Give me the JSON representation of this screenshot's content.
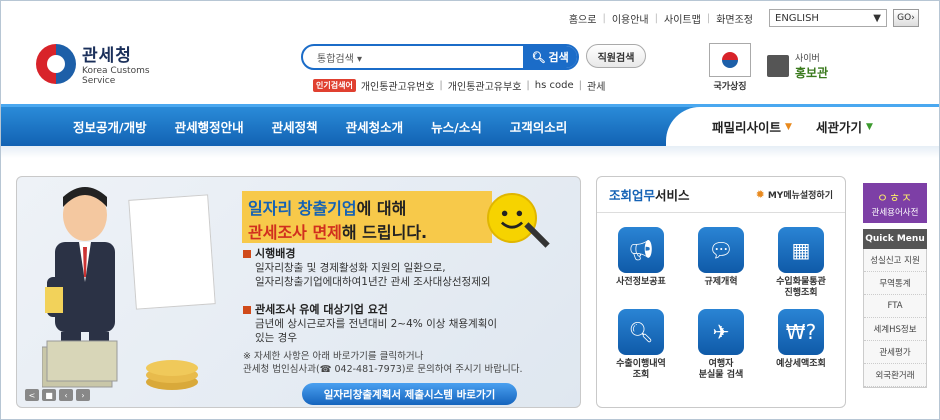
{
  "utility": {
    "home": "홈으로",
    "guide": "이용안내",
    "sitemap": "사이트맵",
    "zoom": "화면조정",
    "language": "ENGLISH",
    "go": "GO"
  },
  "logo": {
    "korean": "관세청",
    "english_line1": "Korea Customs",
    "english_line2": "Service"
  },
  "search": {
    "scope": "통합검색",
    "button": "검색",
    "staff_search": "직원검색"
  },
  "popular": {
    "tag": "인기검색어",
    "terms": [
      "개인통관고유번호",
      "개인통관고유부호",
      "hs code",
      "관세"
    ]
  },
  "flag": {
    "label": "국가상징"
  },
  "cyber": {
    "line1": "사이버",
    "line2": "홍보관"
  },
  "nav": {
    "items": [
      "정보공개/개방",
      "관세행정안내",
      "관세정책",
      "관세청소개",
      "뉴스/소식",
      "고객의소리"
    ],
    "family": "패밀리사이트",
    "tariff": "세관가기"
  },
  "banner": {
    "h1_a": "일자리 창출기업",
    "h1_b": "에 대해",
    "h2_a": "관세조사 면제",
    "h2_b": "해 드립니다.",
    "s1_title": "시행배경",
    "s1_text1": "일자리창출 및 경제활성화 지원의 일환으로,",
    "s1_text2": "일자리창출기업에대하여1년간 관세 조사대상선정제외",
    "s2_title": "관세조사 유예 대상기업 요건",
    "s2_text1": "금년에 상시근로자를 전년대비 2~4% 이상 채용계획이",
    "s2_text2": "있는 경우",
    "note1": "※ 자세한 사항은  아래 바로가기를  클릭하거나",
    "note2": "관세청 법인심사과(☎ 042-481-7973)로 문의하여 주시기 바랍니다.",
    "cta": "일자리창출계획서 제출시스템 바로가기",
    "controls": [
      "<",
      "■",
      "‹",
      "›"
    ]
  },
  "services": {
    "title_a": "조회업무",
    "title_b": "서비스",
    "my_menu": "MY메뉴설정하기",
    "items": [
      {
        "label1": "사전정보공표",
        "label2": "",
        "icon": "megaphone-icon"
      },
      {
        "label1": "규제개혁",
        "label2": "",
        "icon": "speech-bubble-icon"
      },
      {
        "label1": "수입화물통관",
        "label2": "진행조회",
        "icon": "boxes-search-icon"
      },
      {
        "label1": "수출이행내역",
        "label2": "조회",
        "icon": "magnifier-icon"
      },
      {
        "label1": "여행자",
        "label2": "분실물 검색",
        "icon": "airplane-luggage-icon"
      },
      {
        "label1": "예상세액조회",
        "label2": "",
        "icon": "won-question-icon"
      }
    ]
  },
  "quick": {
    "dict_symbol": "ㅇㅎㅈ",
    "dict_label": "관세용어사전",
    "title": "Quick Menu",
    "items": [
      "성실신고 지원",
      "무역통계",
      "FTA",
      "세계HS정보",
      "관세평가",
      "외국환거래"
    ]
  }
}
